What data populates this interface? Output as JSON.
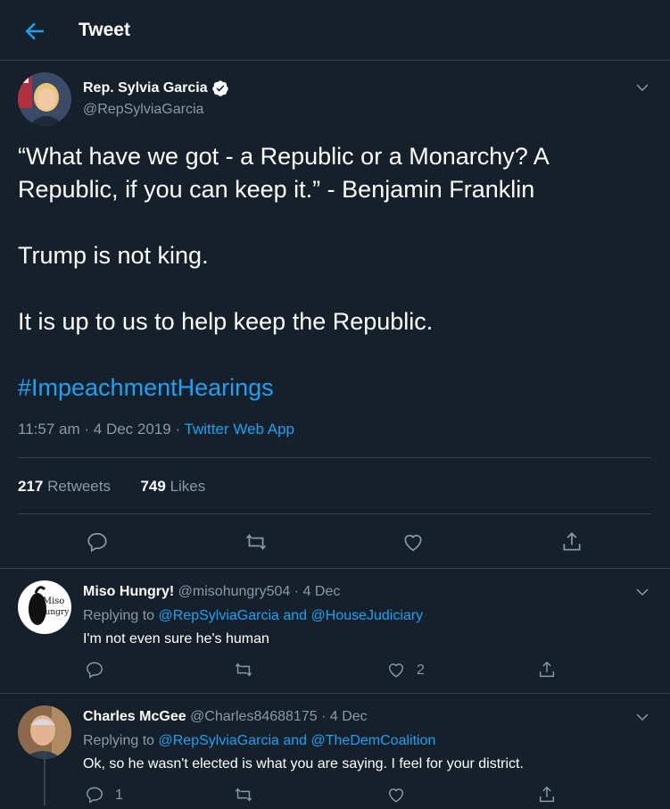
{
  "header": {
    "title": "Tweet"
  },
  "tweet": {
    "author_name": "Rep. Sylvia Garcia",
    "author_handle": "@RepSylviaGarcia",
    "paragraphs": [
      "“What have we got - a Republic or a Monarchy? A Republic, if you can keep it.” - Benjamin Franklin",
      "Trump is not king.",
      "It is up to us to help keep the Republic."
    ],
    "hashtag": "#ImpeachmentHearings",
    "time": "11:57 am",
    "sep1": "·",
    "date": "4 Dec 2019",
    "sep2": "·",
    "source": "Twitter Web App",
    "retweets_count": "217",
    "retweets_label": "Retweets",
    "likes_count": "749",
    "likes_label": "Likes"
  },
  "replies": [
    {
      "name": "Miso Hungry!",
      "handle": "@misohungry504",
      "sep": "·",
      "date": "4 Dec",
      "replying_prefix": "Replying to",
      "mention1": "@RepSylviaGarcia",
      "and_word": "and",
      "mention2": "@HouseJudiciary",
      "text": "I'm not even sure he's human",
      "like_count": "2",
      "avatar_text": "Miso Hungry"
    },
    {
      "name": "Charles McGee",
      "handle": "@Charles84688175",
      "sep": "·",
      "date": "4 Dec",
      "replying_prefix": "Replying to",
      "mention1": "@RepSylviaGarcia",
      "and_word": "and",
      "mention2": "@TheDemCoalition",
      "text": "Ok, so he wasn't elected is what you are saying.  I feel for your district.",
      "reply_count": "1"
    }
  ],
  "icons": {
    "back": "back-arrow-icon",
    "verified": "verified-badge-icon",
    "chevron": "chevron-down-icon",
    "reply": "reply-icon",
    "retweet": "retweet-icon",
    "like": "like-icon",
    "share": "share-icon"
  },
  "colors": {
    "background": "#15202b",
    "accent": "#1da1f2",
    "muted": "#8899a6",
    "border": "#38444d"
  }
}
